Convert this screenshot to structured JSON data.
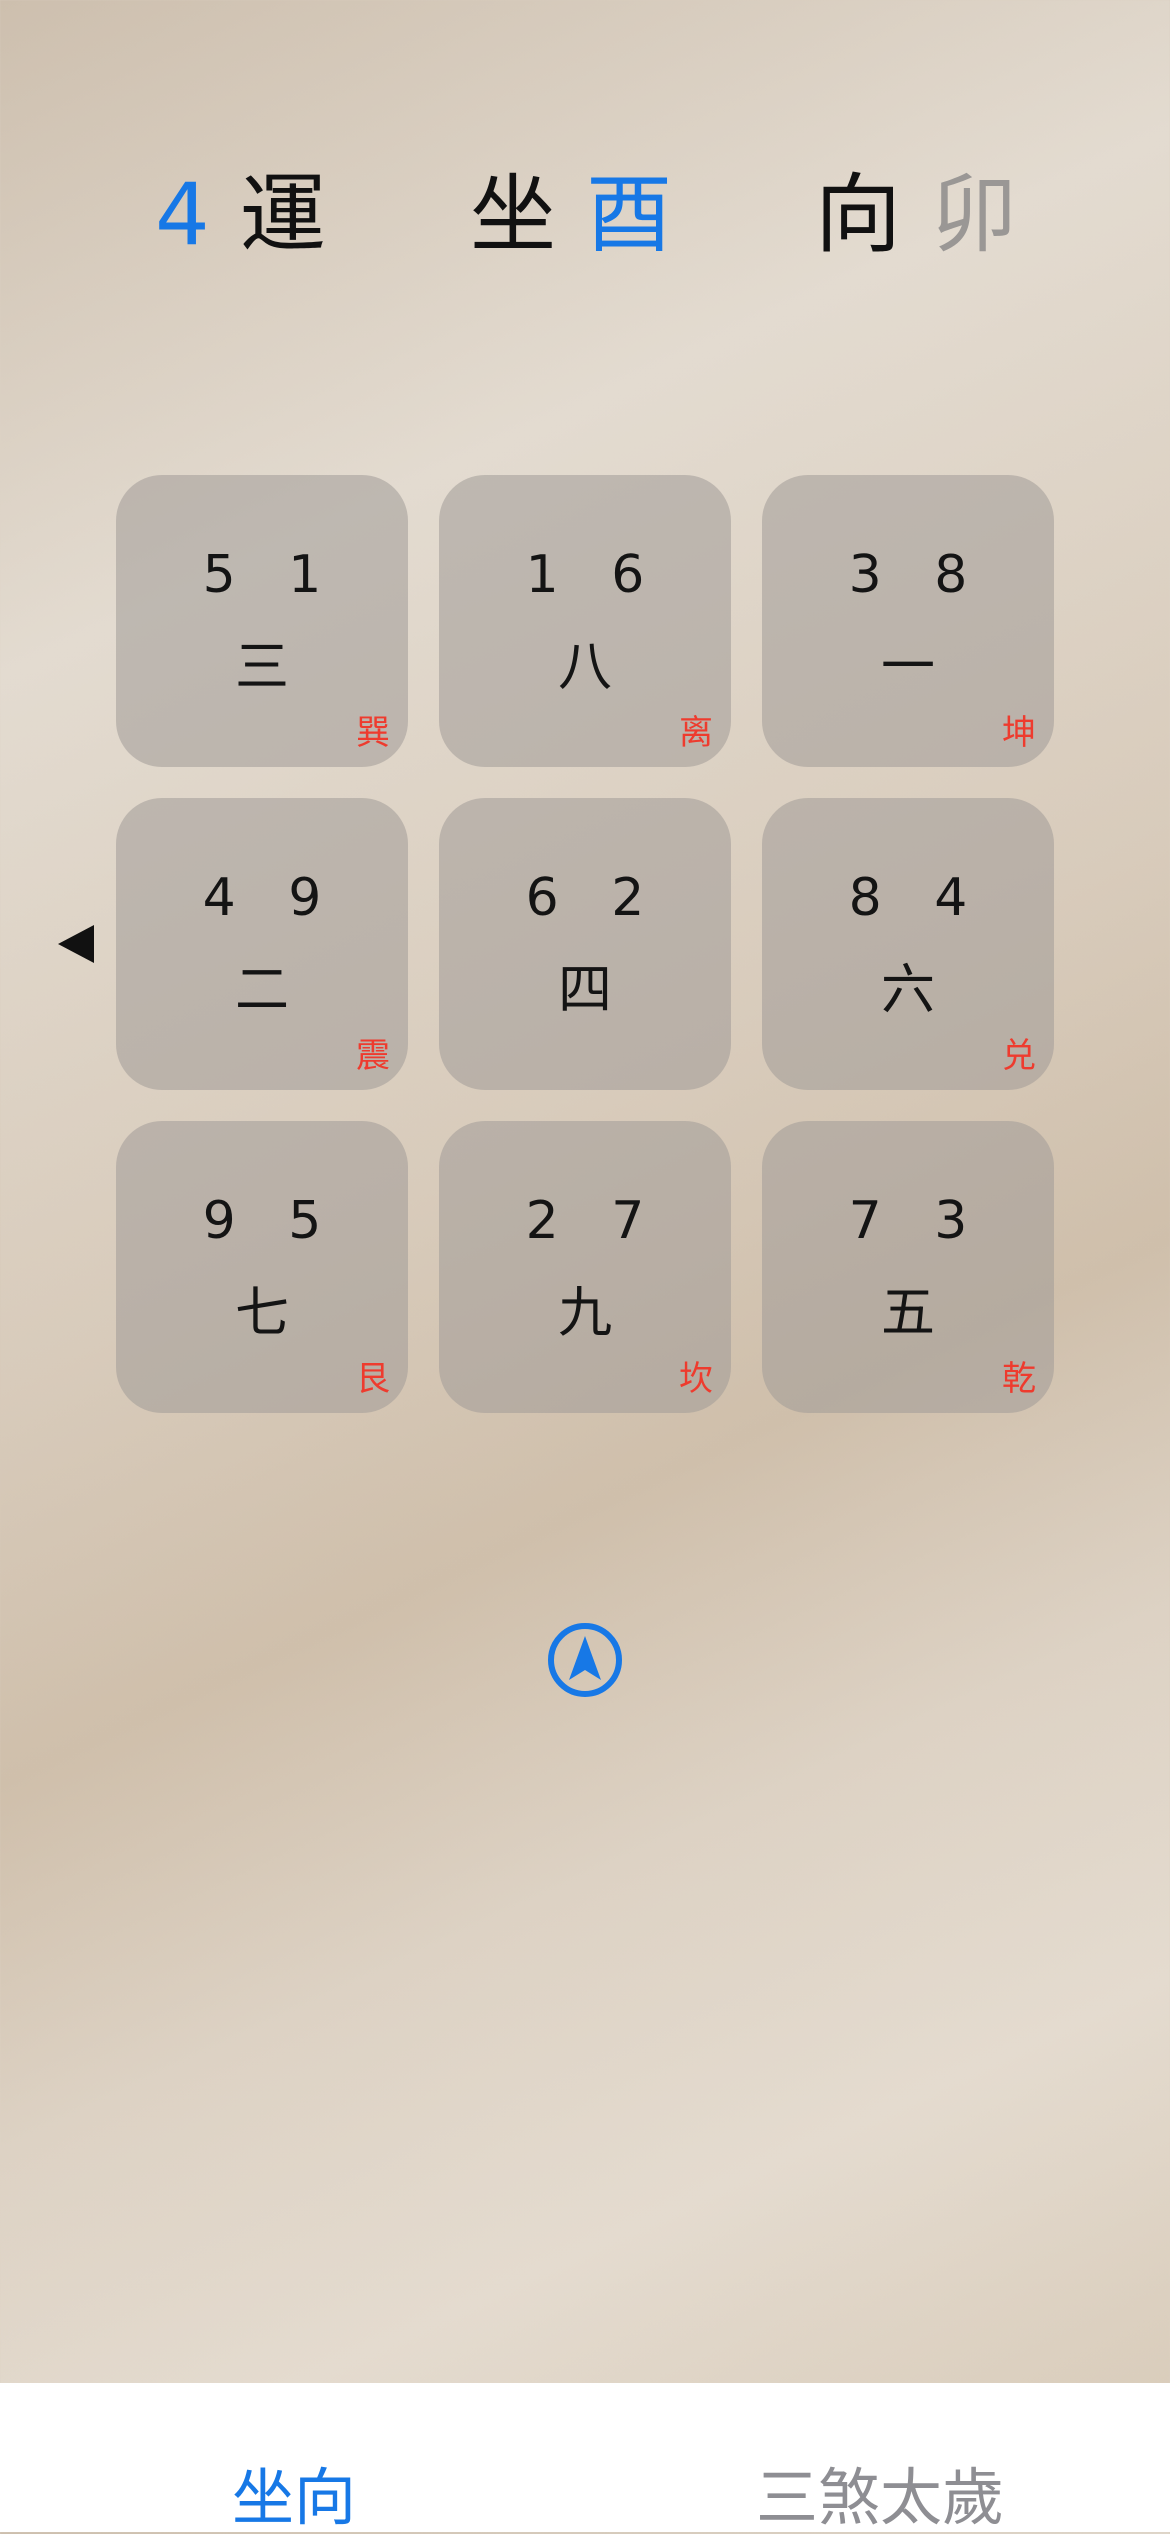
{
  "header": {
    "period_number": "4",
    "period_label": "運",
    "sit_label": "坐",
    "sit_value": "酉",
    "facing_label": "向",
    "facing_value": "卯"
  },
  "grid": [
    {
      "nums": "5 1",
      "star": "三",
      "trigram": "巽"
    },
    {
      "nums": "1 6",
      "star": "八",
      "trigram": "离"
    },
    {
      "nums": "3 8",
      "star": "一",
      "trigram": "坤"
    },
    {
      "nums": "4 9",
      "star": "二",
      "trigram": "震"
    },
    {
      "nums": "6 2",
      "star": "四",
      "trigram": ""
    },
    {
      "nums": "8 4",
      "star": "六",
      "trigram": "兑"
    },
    {
      "nums": "9 5",
      "star": "七",
      "trigram": "艮"
    },
    {
      "nums": "2 7",
      "star": "九",
      "trigram": "坎"
    },
    {
      "nums": "7 3",
      "star": "五",
      "trigram": "乾"
    }
  ],
  "direction_pointer_icon": "left-triangle-icon",
  "navigation_icon": "location-arrow-circle-icon",
  "tabs": [
    {
      "label": "坐向",
      "active": true
    },
    {
      "label": "三煞太歲",
      "active": false
    }
  ],
  "colors": {
    "accent_blue": "#1778e6",
    "trigram_red": "#ee3b2e",
    "inactive_gray": "#9a9795"
  }
}
